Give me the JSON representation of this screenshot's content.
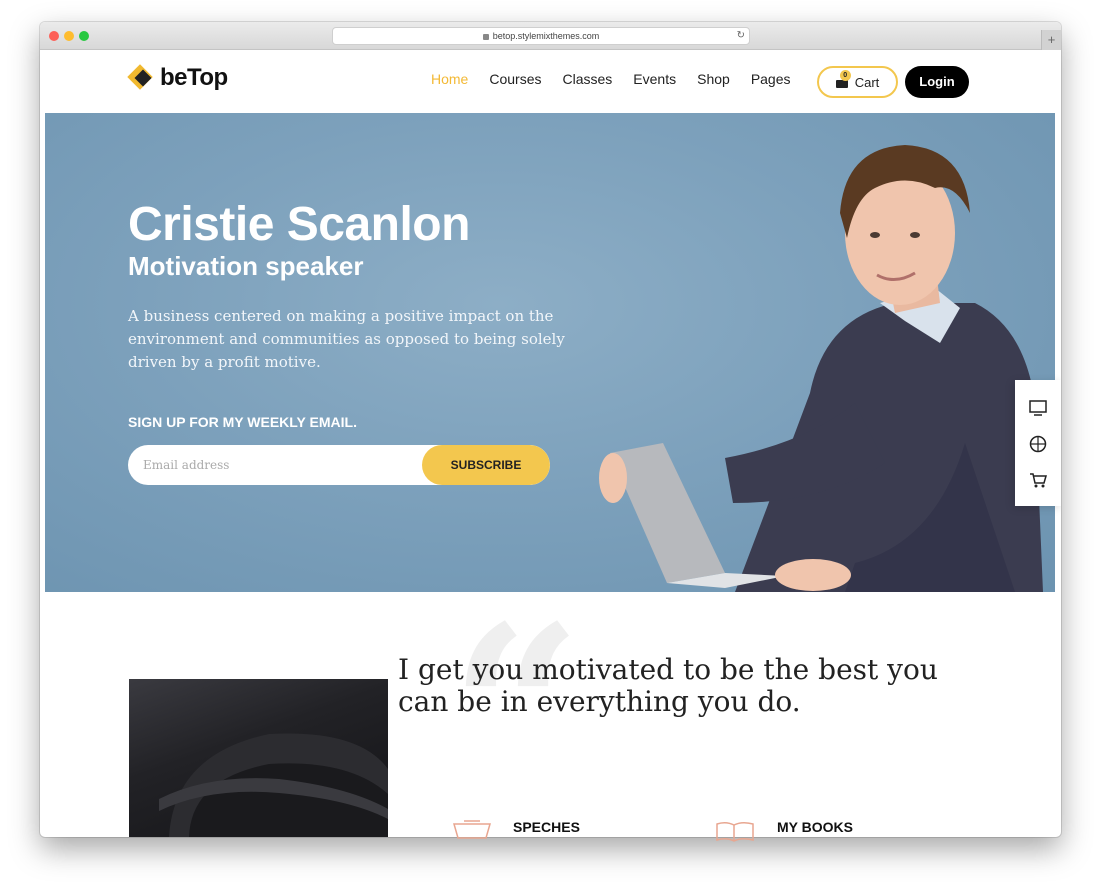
{
  "browser": {
    "url": "betop.stylemixthemes.com",
    "new_tab": "+"
  },
  "brand": {
    "name": "beTop",
    "accent": "#f3b935"
  },
  "nav": {
    "items": [
      "Home",
      "Courses",
      "Classes",
      "Events",
      "Shop",
      "Pages"
    ],
    "active": "Home",
    "cart_label": "Cart",
    "cart_count": "0",
    "login_label": "Login"
  },
  "hero": {
    "title": "Cristie Scanlon",
    "subtitle": "Motivation speaker",
    "description": "A business centered on making a positive impact on the environment and communities as opposed to being solely driven by a profit motive.",
    "signup_label": "SIGN UP FOR MY WEEKLY EMAIL.",
    "email_placeholder": "Email address",
    "subscribe_label": "SUBSCRIBE",
    "background": "#7da1bc"
  },
  "float_bar": {
    "icons": [
      "monitor-icon",
      "globe-icon",
      "cart-icon"
    ]
  },
  "about": {
    "quote": "I get you motivated to be the best you can be in everything you do.",
    "features": [
      {
        "label": "SPECHES",
        "icon": "podium-icon"
      },
      {
        "label": "MY BOOKS",
        "icon": "book-icon"
      }
    ]
  }
}
